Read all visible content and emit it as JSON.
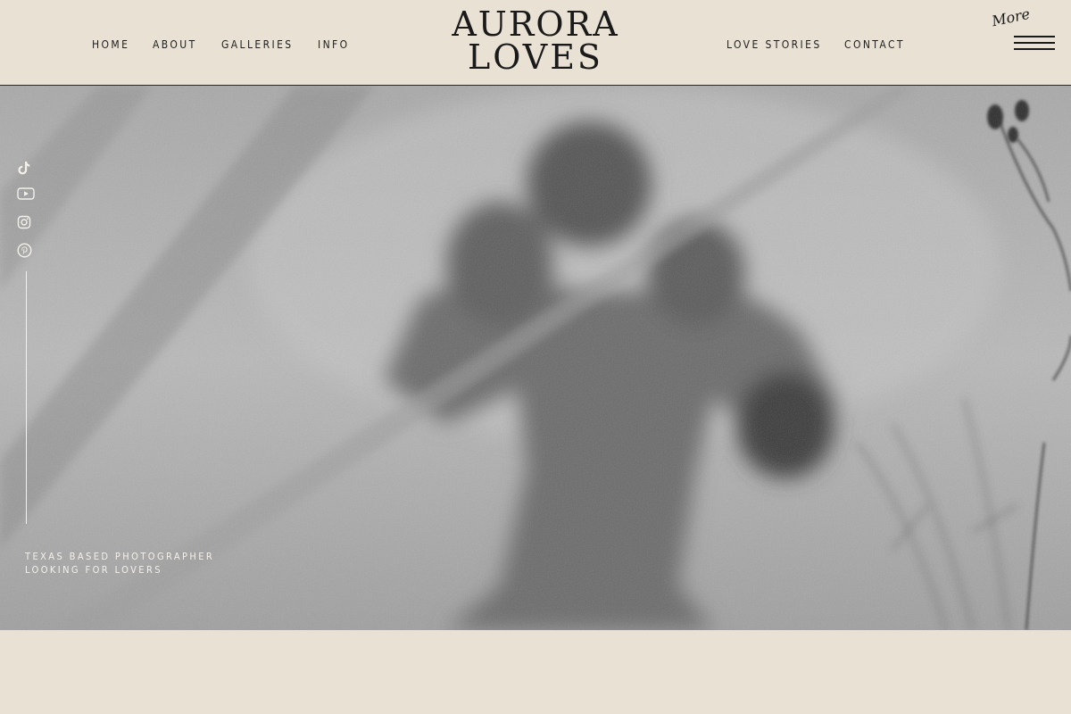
{
  "header": {
    "nav_left": [
      "HOME",
      "ABOUT",
      "GALLERIES",
      "INFO"
    ],
    "nav_right": [
      "LOVE STORIES",
      "CONTACT"
    ],
    "logo_line1": "AURORA",
    "logo_line2": "LOVES",
    "more_label": "More",
    "menu_icon": "hamburger-icon"
  },
  "hero": {
    "tagline_line1": "TEXAS BASED PHOTOGRAPHER",
    "tagline_line2": "LOOKING FOR LOVERS",
    "social_icons": [
      "tiktok-icon",
      "youtube-icon",
      "instagram-icon",
      "pinterest-icon"
    ]
  },
  "colors": {
    "background": "#e8e1d4",
    "text_dark": "#1f1f1f",
    "overlay_text": "#f4f1ea"
  }
}
